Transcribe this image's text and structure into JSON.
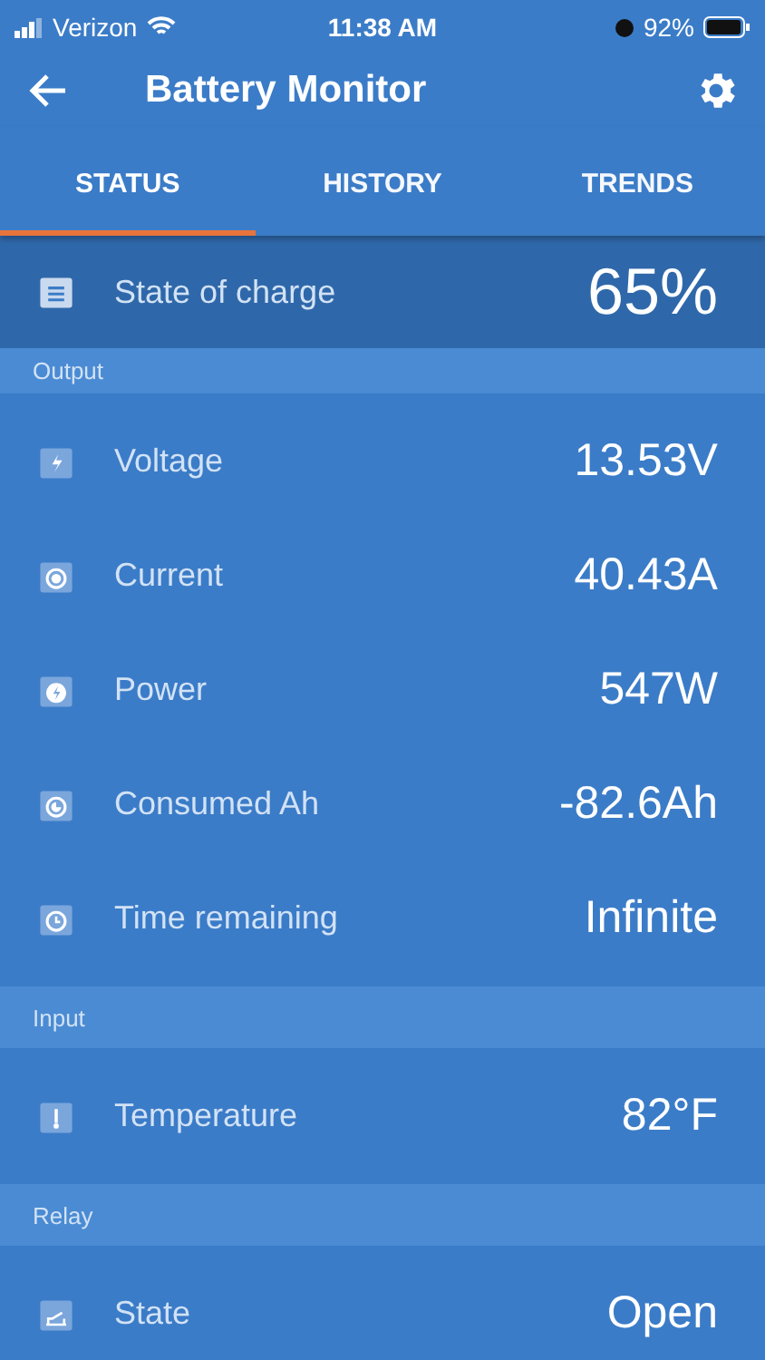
{
  "status_bar": {
    "carrier": "Verizon",
    "time": "11:38 AM",
    "battery": "92%"
  },
  "app_bar": {
    "title": "Battery Monitor"
  },
  "tabs": [
    {
      "label": "STATUS",
      "selected": true
    },
    {
      "label": "HISTORY",
      "selected": false
    },
    {
      "label": "TRENDS",
      "selected": false
    }
  ],
  "summary": {
    "kind": "charge",
    "label": "State of charge",
    "value": "65%"
  },
  "sections": [
    {
      "title": "Output",
      "rows": [
        {
          "kind": "voltage",
          "label": "Voltage",
          "value": "13.53V"
        },
        {
          "kind": "current",
          "label": "Current",
          "value": "40.43A"
        },
        {
          "kind": "power",
          "label": "Power",
          "value": "547W"
        },
        {
          "kind": "consumed",
          "label": "Consumed Ah",
          "value": "-82.6Ah"
        },
        {
          "kind": "time",
          "label": "Time remaining",
          "value": "Infinite"
        }
      ]
    },
    {
      "title": "Input",
      "rows": [
        {
          "kind": "temperature",
          "label": "Temperature",
          "value": "82°F"
        }
      ]
    },
    {
      "title": "Relay",
      "rows": [
        {
          "kind": "relay",
          "label": "State",
          "value": "Open"
        }
      ]
    }
  ]
}
